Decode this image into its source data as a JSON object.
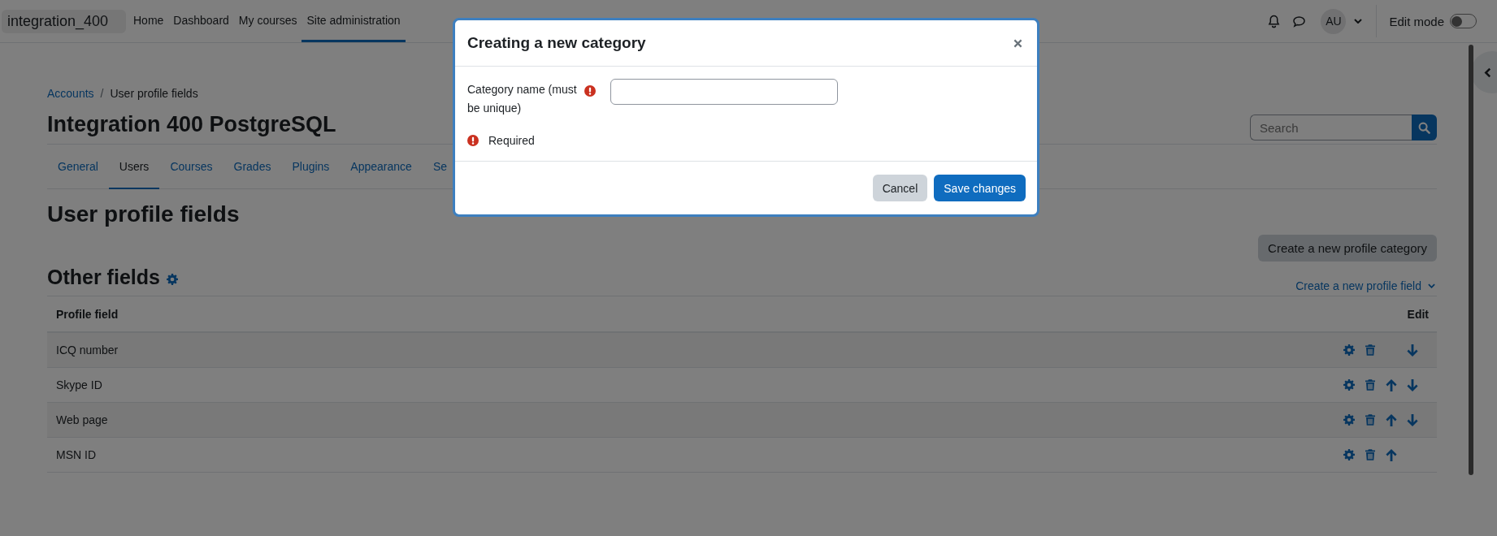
{
  "navbar": {
    "brand": "integration_400",
    "items": [
      {
        "label": "Home",
        "selected": false
      },
      {
        "label": "Dashboard",
        "selected": false
      },
      {
        "label": "My courses",
        "selected": false
      },
      {
        "label": "Site administration",
        "selected": true
      }
    ],
    "avatar": "AU",
    "edit_mode": {
      "label": "Edit mode",
      "on": false
    }
  },
  "breadcrumb": {
    "separator": "/",
    "items": [
      {
        "label": "Accounts",
        "kind": "link"
      },
      {
        "label": "User profile fields",
        "kind": "current"
      }
    ]
  },
  "page_title": "Integration 400 PostgreSQL",
  "search": {
    "placeholder": "Search"
  },
  "tabs": [
    {
      "label": "General",
      "selected": false
    },
    {
      "label": "Users",
      "selected": true
    },
    {
      "label": "Courses",
      "selected": false
    },
    {
      "label": "Grades",
      "selected": false
    },
    {
      "label": "Plugins",
      "selected": false
    },
    {
      "label": "Appearance",
      "selected": false
    },
    {
      "label": "Se",
      "selected": false
    }
  ],
  "heading": "User profile fields",
  "create_category_button": "Create a new profile category",
  "category": {
    "title": "Other fields",
    "create_field_link": "Create a new profile field"
  },
  "table": {
    "columns": [
      "Profile field",
      "Edit"
    ],
    "rows": [
      {
        "name": "ICQ number",
        "move_up": false,
        "move_down": true
      },
      {
        "name": "Skype ID",
        "move_up": true,
        "move_down": true
      },
      {
        "name": "Web page",
        "move_up": true,
        "move_down": true
      },
      {
        "name": "MSN ID",
        "move_up": true,
        "move_down": false
      }
    ]
  },
  "modal": {
    "title": "Creating a new category",
    "field": {
      "label": "Category name (must be unique)",
      "required": true
    },
    "error": "Required",
    "buttons": [
      {
        "label": "Cancel",
        "kind": "secondary"
      },
      {
        "label": "Save changes",
        "kind": "primary"
      }
    ]
  }
}
